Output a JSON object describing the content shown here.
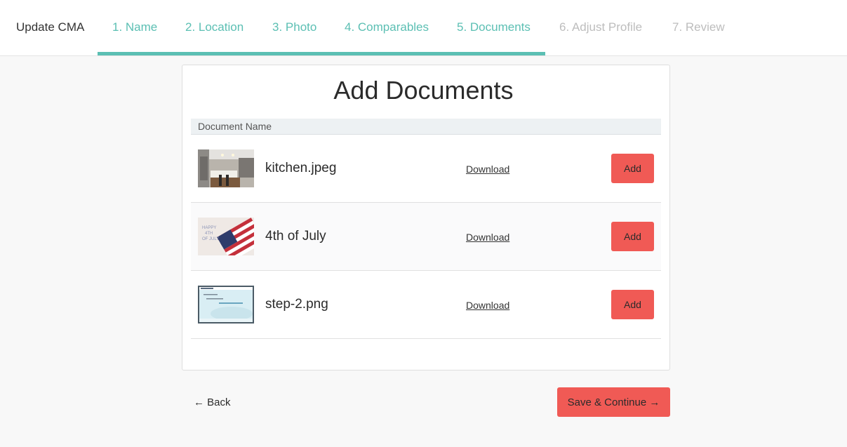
{
  "header": {
    "title": "Update CMA",
    "steps": [
      {
        "label": "1. Name"
      },
      {
        "label": "2. Location"
      },
      {
        "label": "3. Photo"
      },
      {
        "label": "4. Comparables"
      },
      {
        "label": "5. Documents"
      },
      {
        "label": "6. Adjust Profile"
      },
      {
        "label": "7. Review"
      }
    ],
    "progress_fraction": 0.714
  },
  "main": {
    "heading": "Add Documents",
    "column_header": "Document Name",
    "documents": [
      {
        "name": "kitchen.jpeg",
        "download_label": "Download",
        "add_label": "Add",
        "thumb_icon": "kitchen-photo"
      },
      {
        "name": "4th of July",
        "download_label": "Download",
        "add_label": "Add",
        "thumb_icon": "flag-photo",
        "thumb_text": [
          "HAPPY",
          "4TH",
          "OF JULY"
        ]
      },
      {
        "name": "step-2.png",
        "download_label": "Download",
        "add_label": "Add",
        "thumb_icon": "screenshot-thumbnail"
      }
    ]
  },
  "footer": {
    "back_label": "← Back",
    "save_label": "Save & Continue →"
  },
  "colors": {
    "accent_teal": "#5bbfb3",
    "accent_red": "#f05a55",
    "inactive_step": "#bdbdbd"
  }
}
